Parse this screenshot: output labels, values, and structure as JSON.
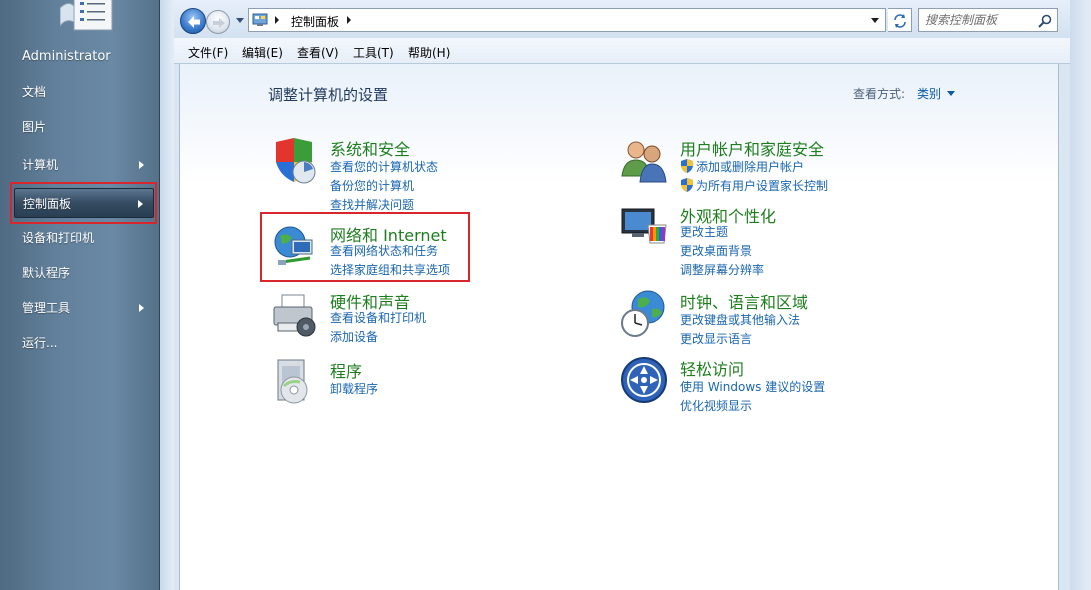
{
  "start_menu": {
    "user": "Administrator",
    "items": [
      {
        "label": "文档",
        "has_submenu": false
      },
      {
        "label": "图片",
        "has_submenu": false
      },
      {
        "label": "计算机",
        "has_submenu": true
      },
      {
        "label": "控制面板",
        "has_submenu": true,
        "selected": true
      },
      {
        "label": "设备和打印机",
        "has_submenu": false
      },
      {
        "label": "默认程序",
        "has_submenu": false
      },
      {
        "label": "管理工具",
        "has_submenu": true
      },
      {
        "label": "运行...",
        "has_submenu": false
      }
    ]
  },
  "address_bar": {
    "path": "控制面板",
    "search_placeholder": "搜索控制面板"
  },
  "menu_bar": [
    "文件(F)",
    "编辑(E)",
    "查看(V)",
    "工具(T)",
    "帮助(H)"
  ],
  "content": {
    "title": "调整计算机的设置",
    "view_by_label": "查看方式:",
    "view_by_value": "类别",
    "categories": [
      {
        "title": "系统和安全",
        "icon": "shield-icon",
        "links": [
          "查看您的计算机状态",
          "备份您的计算机",
          "查找并解决问题"
        ]
      },
      {
        "title": "网络和 Internet",
        "icon": "network-globe-icon",
        "highlighted": true,
        "links": [
          "查看网络状态和任务",
          "选择家庭组和共享选项"
        ]
      },
      {
        "title": "硬件和声音",
        "icon": "printer-icon",
        "links": [
          "查看设备和打印机",
          "添加设备"
        ]
      },
      {
        "title": "程序",
        "icon": "programs-icon",
        "links": [
          "卸载程序"
        ]
      },
      {
        "title": "用户帐户和家庭安全",
        "icon": "users-icon",
        "links": [
          "添加或删除用户帐户",
          "为所有用户设置家长控制"
        ]
      },
      {
        "title": "外观和个性化",
        "icon": "monitor-palette-icon",
        "links": [
          "更改主题",
          "更改桌面背景",
          "调整屏幕分辨率"
        ]
      },
      {
        "title": "时钟、语言和区域",
        "icon": "clock-globe-icon",
        "links": [
          "更改键盘或其他输入法",
          "更改显示语言"
        ]
      },
      {
        "title": "轻松访问",
        "icon": "ease-of-access-icon",
        "links": [
          "使用 Windows 建议的设置",
          "优化视频显示"
        ]
      }
    ]
  },
  "colors": {
    "category_title": "#1e7e1e",
    "link": "#1a66b0",
    "highlight_border": "#d9262d"
  }
}
